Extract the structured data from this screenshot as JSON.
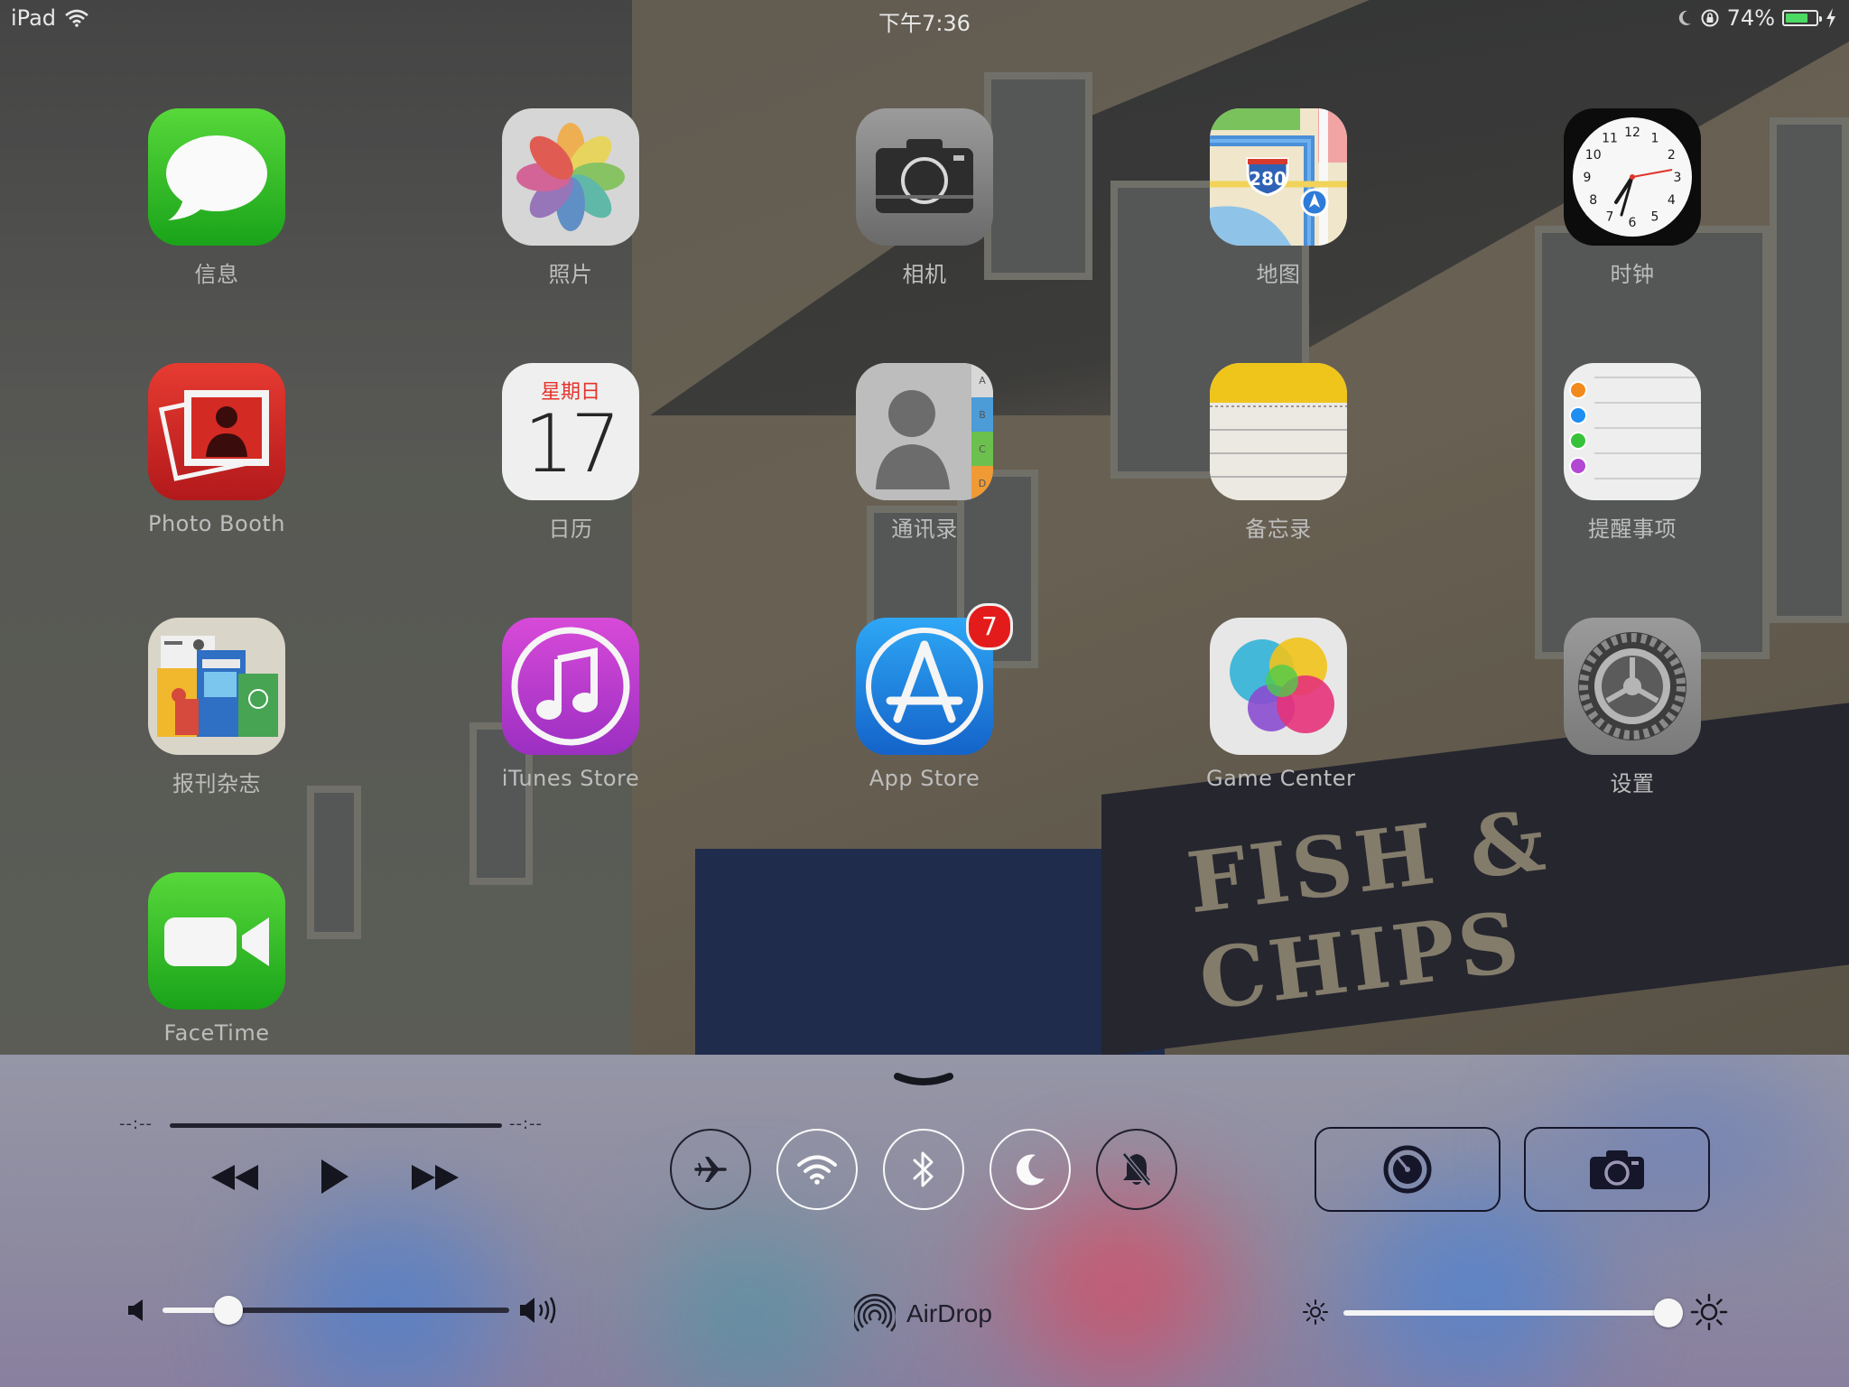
{
  "status_bar": {
    "device": "iPad",
    "time": "下午7:36",
    "battery_text": "74%",
    "battery_level": 0.74,
    "icons": [
      "wifi-icon",
      "moon-icon",
      "rotation-lock-icon",
      "battery-icon",
      "charging-bolt-icon"
    ]
  },
  "apps": [
    {
      "label": "信息",
      "icon": "messages-icon"
    },
    {
      "label": "照片",
      "icon": "photos-icon"
    },
    {
      "label": "相机",
      "icon": "camera-icon"
    },
    {
      "label": "地图",
      "icon": "maps-icon",
      "route_number": "280"
    },
    {
      "label": "时钟",
      "icon": "clock-icon",
      "numerals": [
        "12",
        "1",
        "2",
        "3",
        "4",
        "5",
        "6",
        "7",
        "8",
        "9",
        "10",
        "11"
      ]
    },
    {
      "label": "Photo Booth",
      "icon": "photo-booth-icon"
    },
    {
      "label": "日历",
      "icon": "calendar-icon",
      "weekday": "星期日",
      "day": "17"
    },
    {
      "label": "通讯录",
      "icon": "contacts-icon",
      "tabs": [
        "A",
        "B",
        "C",
        "D"
      ]
    },
    {
      "label": "备忘录",
      "icon": "notes-icon"
    },
    {
      "label": "提醒事项",
      "icon": "reminders-icon"
    },
    {
      "label": "报刊杂志",
      "icon": "newsstand-icon"
    },
    {
      "label": "iTunes Store",
      "icon": "itunes-store-icon"
    },
    {
      "label": "App Store",
      "icon": "app-store-icon",
      "badge": "7"
    },
    {
      "label": "Game Center",
      "icon": "game-center-icon"
    },
    {
      "label": "设置",
      "icon": "settings-icon"
    },
    {
      "label": "FaceTime",
      "icon": "facetime-icon"
    }
  ],
  "wallpaper": {
    "sign_text": "FISH & CHIPS"
  },
  "control_center": {
    "music": {
      "elapsed": "--:--",
      "remaining": "--:--",
      "progress": 0
    },
    "toggles": [
      {
        "name": "airplane-mode",
        "icon": "airplane-icon",
        "on": false
      },
      {
        "name": "wifi",
        "icon": "wifi-icon",
        "on": true
      },
      {
        "name": "bluetooth",
        "icon": "bluetooth-icon",
        "on": true
      },
      {
        "name": "do-not-disturb",
        "icon": "moon-icon",
        "on": true
      },
      {
        "name": "mute",
        "icon": "bell-slash-icon",
        "on": false
      }
    ],
    "quick_launch": [
      {
        "name": "timer",
        "icon": "timer-icon"
      },
      {
        "name": "camera",
        "icon": "camera-icon"
      }
    ],
    "volume": 0.19,
    "brightness": 1.0,
    "airdrop_label": "AirDrop",
    "colors": {
      "on_ring": "#fafafa",
      "off_ring": "#1f1f2c",
      "slider_fill": "#f4f4f4",
      "slider_rest": "#2a2a3a"
    }
  }
}
